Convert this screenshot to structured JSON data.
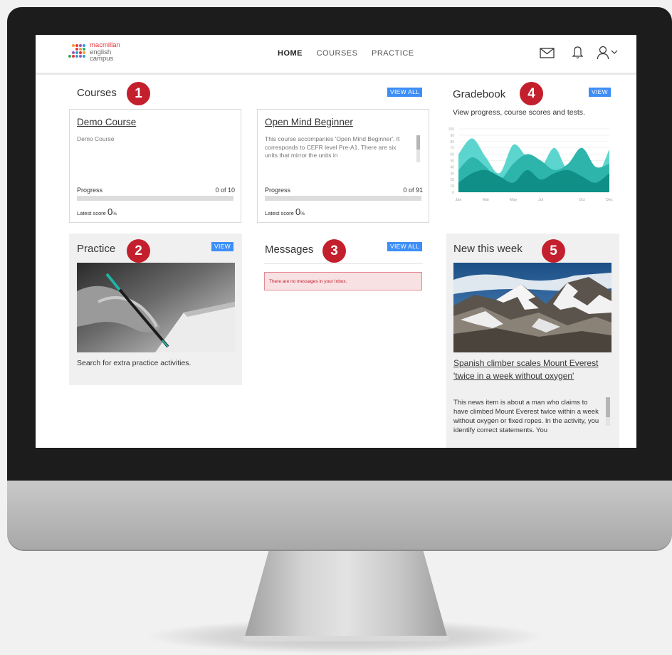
{
  "logo": {
    "line1": "macmillan",
    "line2": "english",
    "line3": "campus"
  },
  "nav": {
    "items": [
      "HOME",
      "COURSES",
      "PRACTICE"
    ],
    "active": "HOME"
  },
  "courses": {
    "title": "Courses",
    "badge": "1",
    "view_all": "VIEW ALL",
    "cards": [
      {
        "title": "Demo Course",
        "description": "Demo Course",
        "progress_label": "Progress",
        "progress_value": "0 of 10",
        "progress_fraction": 0,
        "latest_label": "Latest score",
        "latest_value": "0",
        "latest_unit": "%"
      },
      {
        "title": "Open Mind Beginner",
        "description": "This course accompanies 'Open Mind Beginner'. It corresponds to CEFR level Pre-A1. There are six units that mirror the units in",
        "progress_label": "Progress",
        "progress_value": "0 of 91",
        "progress_fraction": 0,
        "latest_label": "Latest score",
        "latest_value": "0",
        "latest_unit": "%"
      }
    ]
  },
  "gradebook": {
    "title": "Gradebook",
    "badge": "4",
    "view": "VIEW",
    "subtitle": "View progress, course scores and tests."
  },
  "chart_data": {
    "type": "area",
    "categories": [
      "Jan",
      "Feb",
      "Mar",
      "Apr",
      "May",
      "Jun",
      "Jul",
      "Aug",
      "Sep",
      "Oct",
      "Nov",
      "Dec"
    ],
    "x_tick_labels": [
      "Jan",
      "Mar",
      "May",
      "Jul",
      "Oct",
      "Dec"
    ],
    "y_ticks": [
      0,
      10,
      20,
      30,
      40,
      50,
      60,
      70,
      80,
      90,
      100
    ],
    "ylim": [
      0,
      100
    ],
    "series": [
      {
        "values": [
          60,
          85,
          55,
          30,
          75,
          55,
          40,
          70,
          35,
          60,
          25,
          68
        ],
        "color": "#5dd5cf"
      },
      {
        "values": [
          35,
          55,
          40,
          20,
          45,
          60,
          50,
          35,
          45,
          70,
          40,
          45
        ],
        "color": "#2db4ab"
      },
      {
        "values": [
          15,
          30,
          35,
          25,
          15,
          35,
          20,
          30,
          35,
          25,
          15,
          30
        ],
        "color": "#108f87"
      }
    ],
    "grid": true,
    "title": "",
    "xlabel": "",
    "ylabel": ""
  },
  "practice": {
    "title": "Practice",
    "badge": "2",
    "view": "VIEW",
    "description": "Search for extra practice activities."
  },
  "messages": {
    "title": "Messages",
    "badge": "3",
    "view_all": "VIEW ALL",
    "empty_text": "There are no messages in your Inbox."
  },
  "news": {
    "title": "New this week",
    "badge": "5",
    "headline": "Spanish climber scales Mount Everest 'twice in a week without oxygen'",
    "description": "This news item is about a man who claims to have climbed Mount Everest twice within a week without oxygen or fixed ropes. In the activity, you identify correct statements. You"
  },
  "icons": {
    "mail": "mail-icon",
    "bell": "bell-icon",
    "user": "user-icon",
    "chevron": "chevron-down-icon"
  },
  "colors": {
    "accent_blue": "#3e8ef7",
    "badge_red": "#c31f2c",
    "alert_bg": "#f8e1e3",
    "chart_light": "#5dd5cf",
    "chart_mid": "#2db4ab",
    "chart_dark": "#108f87"
  }
}
